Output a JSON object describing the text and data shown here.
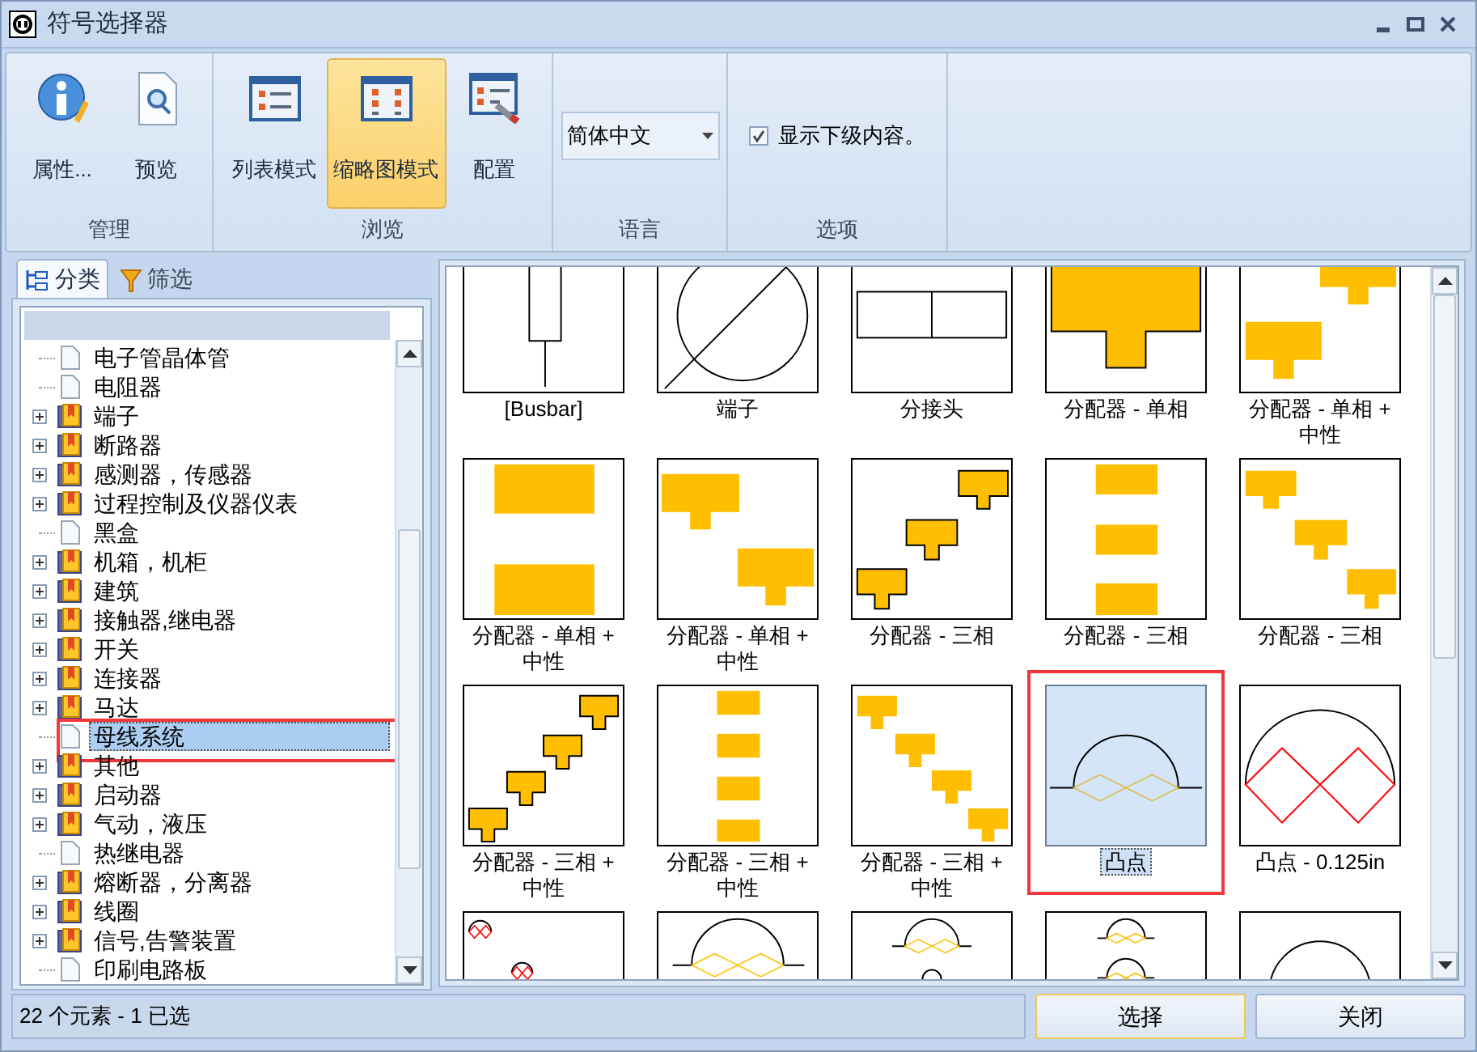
{
  "window": {
    "title": "符号选择器"
  },
  "ribbon": {
    "groups": [
      {
        "label": "管理",
        "buttons": [
          {
            "kind": "properties",
            "label": "属性...",
            "selected": false
          },
          {
            "kind": "preview",
            "label": "预览",
            "selected": false
          }
        ]
      },
      {
        "label": "浏览",
        "buttons": [
          {
            "kind": "list-view",
            "label": "列表模式",
            "selected": false
          },
          {
            "kind": "thumbnail-view",
            "label": "缩略图模式",
            "selected": true
          },
          {
            "kind": "configure",
            "label": "配置",
            "selected": false
          }
        ]
      },
      {
        "label": "语言",
        "dropdown": {
          "value": "简体中文"
        }
      },
      {
        "label": "选项",
        "checkbox": {
          "label": "显示下级内容。",
          "checked": true
        }
      }
    ]
  },
  "left_tabs": [
    {
      "label": "分类",
      "selected": true
    },
    {
      "label": "筛选",
      "selected": false
    }
  ],
  "tree": {
    "items": [
      {
        "label": "电子管晶体管",
        "kind": "leaf",
        "selected": false
      },
      {
        "label": "电阻器",
        "kind": "leaf",
        "selected": false
      },
      {
        "label": "端子",
        "kind": "folder",
        "expanded": false,
        "selected": false
      },
      {
        "label": "断路器",
        "kind": "folder",
        "expanded": false,
        "selected": false
      },
      {
        "label": "感测器，传感器",
        "kind": "folder",
        "expanded": false,
        "selected": false
      },
      {
        "label": "过程控制及仪器仪表",
        "kind": "folder",
        "expanded": false,
        "selected": false
      },
      {
        "label": "黑盒",
        "kind": "leaf",
        "selected": false
      },
      {
        "label": "机箱，机柜",
        "kind": "folder",
        "expanded": false,
        "selected": false
      },
      {
        "label": "建筑",
        "kind": "folder",
        "expanded": false,
        "selected": false
      },
      {
        "label": "接触器,继电器",
        "kind": "folder",
        "expanded": false,
        "selected": false
      },
      {
        "label": "开关",
        "kind": "folder",
        "expanded": false,
        "selected": false
      },
      {
        "label": "连接器",
        "kind": "folder",
        "expanded": false,
        "selected": false
      },
      {
        "label": "马达",
        "kind": "folder",
        "expanded": false,
        "selected": false
      },
      {
        "label": "母线系统",
        "kind": "leaf",
        "selected": true,
        "callout": true
      },
      {
        "label": "其他",
        "kind": "folder",
        "expanded": false,
        "selected": false
      },
      {
        "label": "启动器",
        "kind": "folder",
        "expanded": false,
        "selected": false
      },
      {
        "label": "气动，液压",
        "kind": "folder",
        "expanded": false,
        "selected": false
      },
      {
        "label": "热继电器",
        "kind": "leaf",
        "selected": false
      },
      {
        "label": "熔断器，分离器",
        "kind": "folder",
        "expanded": false,
        "selected": false
      },
      {
        "label": "线圈",
        "kind": "folder",
        "expanded": false,
        "selected": false
      },
      {
        "label": "信号,告警装置",
        "kind": "folder",
        "expanded": false,
        "selected": false
      },
      {
        "label": "印刷电路板",
        "kind": "leaf",
        "selected": false
      }
    ]
  },
  "symbols": [
    {
      "kind": "busbar",
      "label": "[Busbar]",
      "selected": false
    },
    {
      "kind": "terminal",
      "label": "端子",
      "selected": false
    },
    {
      "kind": "splice",
      "label": "分接头",
      "selected": false
    },
    {
      "kind": "tee-1",
      "label": "分配器 - 单相",
      "selected": false
    },
    {
      "kind": "tee-2",
      "label": "分配器 - 单相 + 中性",
      "selected": false
    },
    {
      "kind": "rects-2",
      "label": "分配器 - 单相 + 中性",
      "selected": false
    },
    {
      "kind": "tees-2",
      "label": "分配器 - 单相 + 中性",
      "selected": false
    },
    {
      "kind": "tees-3-outline",
      "label": "分配器 - 三相",
      "selected": false
    },
    {
      "kind": "rects-3",
      "label": "分配器 - 三相",
      "selected": false
    },
    {
      "kind": "tees-3",
      "label": "分配器 - 三相",
      "selected": false
    },
    {
      "kind": "tees-4-outline",
      "label": "分配器 - 三相 + 中性",
      "selected": false
    },
    {
      "kind": "rects-4",
      "label": "分配器 - 三相 + 中性",
      "selected": false
    },
    {
      "kind": "tees-4",
      "label": "分配器 - 三相 + 中性",
      "selected": false
    },
    {
      "kind": "bump",
      "label": "凸点",
      "selected": true,
      "callout": true
    },
    {
      "kind": "bump-red",
      "label": "凸点 - 0.125in",
      "selected": false
    },
    {
      "kind": "small-red-circles",
      "selected": false
    },
    {
      "kind": "bump-wide",
      "selected": false
    },
    {
      "kind": "bump-pair",
      "selected": false
    },
    {
      "kind": "bumps-stacked",
      "selected": false
    },
    {
      "kind": "arc",
      "selected": false
    }
  ],
  "status_bar": {
    "text": "22 个元素 - 1 已选"
  },
  "buttons": [
    "选择",
    "关闭"
  ]
}
